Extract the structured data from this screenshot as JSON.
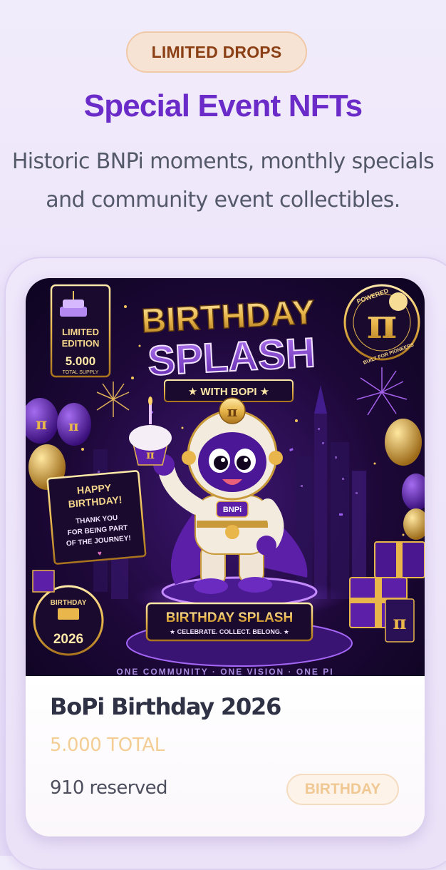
{
  "header": {
    "badge": "LIMITED DROPS",
    "title": "Special Event NFTs",
    "subtitle_line1": "Historic BNPi moments, monthly specials",
    "subtitle_line2": "and community event collectibles."
  },
  "nft": {
    "artwork": {
      "title_line1": "BIRTHDAY",
      "title_line2": "SPLASH",
      "ribbon": "★ WITH BOPI ★",
      "limited_line1": "LIMITED",
      "limited_line2": "EDITION",
      "limited_supply": "5.000",
      "limited_supply_label": "TOTAL SUPPLY",
      "seal_top": "POWERED",
      "seal_bottom": "BUILT FOR PIONEERS",
      "pi_symbol": "π",
      "sign_line1": "HAPPY",
      "sign_line2": "BIRTHDAY!",
      "sign_line3": "THANK YOU",
      "sign_line4": "FOR BEING PART",
      "sign_line5": "OF THE JOURNEY!",
      "belly_badge": "BNPi",
      "birthday_badge_top": "BIRTHDAY",
      "birthday_badge_year": "2026",
      "plaque_title": "BIRTHDAY SPLASH",
      "plaque_sub": "★ CELEBRATE. COLLECT. BELONG. ★",
      "footer_strip": "ONE COMMUNITY · ONE VISION · ONE PI"
    },
    "name": "BoPi Birthday 2026",
    "supply": "5.000 TOTAL",
    "reserved": "910 reserved",
    "category": "BIRTHDAY"
  },
  "colors": {
    "accent_purple": "#6a2bc8",
    "badge_text": "#8a3f14",
    "gold": "#e8b64a"
  }
}
